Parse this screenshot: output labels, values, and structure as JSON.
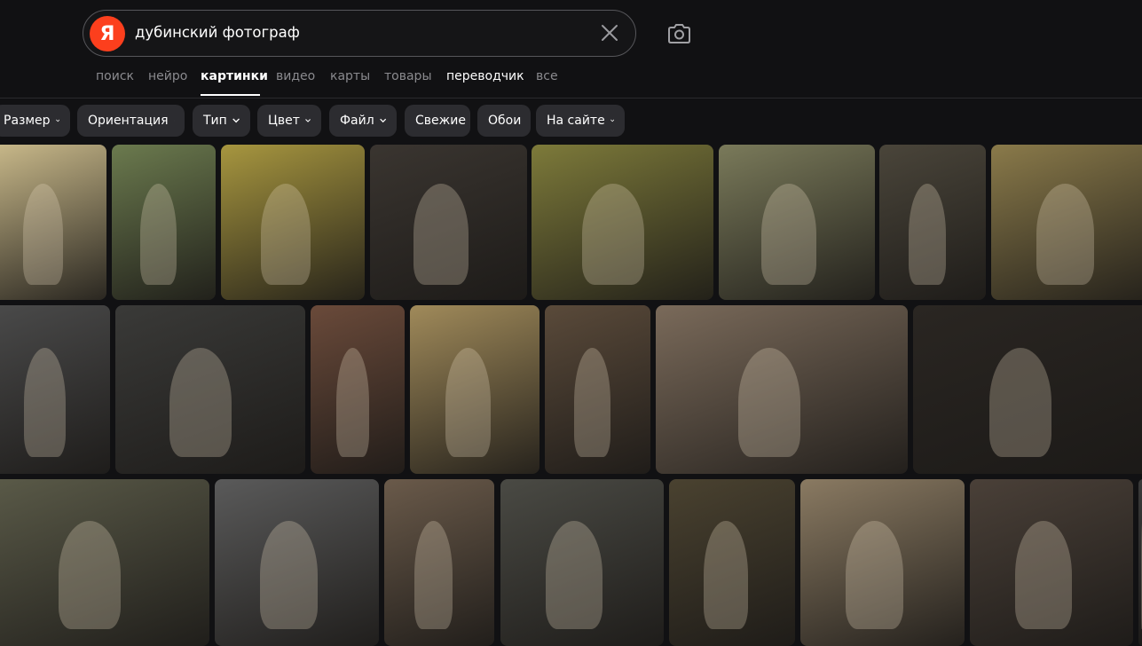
{
  "search": {
    "query": "дубинский фотограф",
    "logo_letter": "Я",
    "logo_color": "#fc3f1d",
    "clear_icon": "close-icon",
    "camera_icon": "camera-search-icon"
  },
  "tabs": [
    {
      "label": "поиск"
    },
    {
      "label": "нейро"
    },
    {
      "label": "картинки",
      "active": true
    },
    {
      "label": "видео"
    },
    {
      "label": "карты"
    },
    {
      "label": "товары"
    },
    {
      "label": "переводчик"
    },
    {
      "label": "все"
    }
  ],
  "filters": [
    {
      "label": "Размер",
      "has_dropdown": true
    },
    {
      "label": "Ориентация",
      "has_dropdown": true
    },
    {
      "label": "Тип",
      "has_dropdown": true
    },
    {
      "label": "Цвет",
      "has_dropdown": true
    },
    {
      "label": "Файл",
      "has_dropdown": true
    },
    {
      "label": "Свежие",
      "has_dropdown": false
    },
    {
      "label": "Обои",
      "has_dropdown": false
    },
    {
      "label": "На сайте",
      "has_dropdown": true
    }
  ],
  "results": {
    "row1": [
      "#c9b98a",
      "#6b7a4e",
      "#a7963f",
      "#3a3530",
      "#7d7a3a",
      "#7a7a5a",
      "#4a453a",
      "#8a7a4a"
    ],
    "row2": [
      "#4a4a4a",
      "#3a3a38",
      "#6a4a3a",
      "#a08a5a",
      "#5a4a3a",
      "#7a6a5a",
      "#2a2622"
    ],
    "row3": [
      "#5a5a48",
      "#5a5a5a",
      "#6a5a4a",
      "#4a4a44",
      "#4a4230",
      "#8a7a62",
      "#4a4038",
      "#3a3a3a"
    ]
  }
}
